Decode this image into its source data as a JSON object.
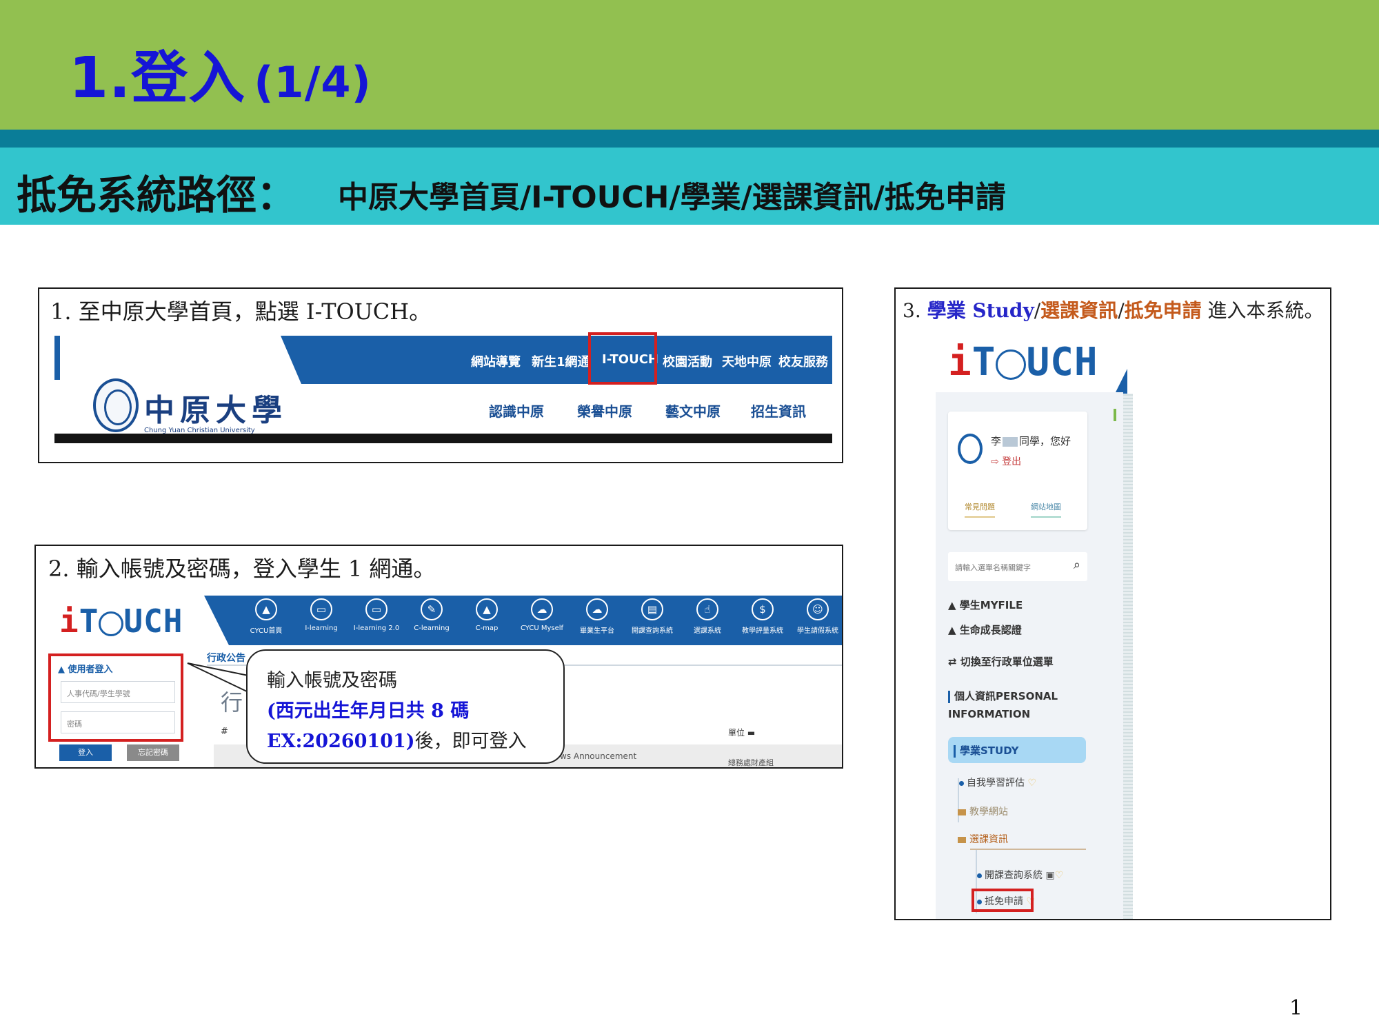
{
  "slide": {
    "title": "1.登入",
    "page_fraction": "(1/4)",
    "path_label": "抵免系統路徑：",
    "path_text": "中原大學首頁/I-TOUCH/學業/選課資訊/抵免申請",
    "page_number": "1"
  },
  "step1": {
    "caption": "1. 至中原大學首頁，點選 I-TOUCH。",
    "top_nav": [
      "網站導覽",
      "新生1網通",
      "I-TOUCH",
      "校園活動",
      "天地中原",
      "校友服務"
    ],
    "logo_cn": "中原大學",
    "logo_en": "Chung Yuan Christian University",
    "sub_nav": [
      "認識中原",
      "榮譽中原",
      "藝文中原",
      "招生資訊"
    ]
  },
  "step2": {
    "caption": "2. 輸入帳號及密碼，登入學生 1 網通。",
    "logo": {
      "i": "i",
      "t": "T",
      "uch": "UCH"
    },
    "nav_items": [
      {
        "icon": "building-icon",
        "glyph": "▲",
        "label": "CYCU首頁"
      },
      {
        "icon": "monitor-icon",
        "glyph": "▭",
        "label": "I-learning"
      },
      {
        "icon": "monitor-new-icon",
        "glyph": "▭",
        "label": "I-learning 2.0"
      },
      {
        "icon": "pencil-icon",
        "glyph": "✎",
        "label": "C-learning"
      },
      {
        "icon": "mountain-icon",
        "glyph": "▲",
        "label": "C-map"
      },
      {
        "icon": "cloud-icon",
        "glyph": "☁",
        "label": "CYCU Myself"
      },
      {
        "icon": "cloud-icon",
        "glyph": "☁",
        "label": "畢業生平台"
      },
      {
        "icon": "chat-icon",
        "glyph": "▤",
        "label": "開課查詢系統"
      },
      {
        "icon": "pointer-icon",
        "glyph": "☝",
        "label": "選課系統"
      },
      {
        "icon": "dollar-icon",
        "glyph": "$",
        "label": "教學評量系統"
      },
      {
        "icon": "person-icon",
        "glyph": "☺",
        "label": "學生請假系統"
      }
    ],
    "login": {
      "title": "使用者登入",
      "account_placeholder": "人事代碼/學生學號",
      "password_placeholder": "密碼",
      "login_button": "登入",
      "forgot_button": "忘記密碼"
    },
    "admin_tab": "行政公告",
    "big_char": "行",
    "col_hash": "#",
    "col_unit": "單位 ▬",
    "row_text": "ws Announcement",
    "row_text2": "總務處財產組",
    "callout": {
      "line1": "輸入帳號及密碼",
      "line2": "(西元出生年月日共 8 碼",
      "line3_code": "EX:20260101)",
      "line3_rest": "後，即可登入"
    }
  },
  "step3": {
    "caption_prefix": "3. ",
    "caption_study": "學業 Study",
    "caption_sep1": "/",
    "caption_course": "選課資訊",
    "caption_sep2": "/",
    "caption_apply": "抵免申請",
    "caption_suffix": " 進入本系統。",
    "user_name_pre": "李",
    "user_name_post": "同學，您好",
    "logout": "⇨ 登出",
    "faq": "常見問題",
    "sitemap": "網站地圖",
    "search_placeholder": "請輸入選單名稱關鍵字",
    "menu": {
      "myfile": "學生MYFILE",
      "growth": "生命成長認證",
      "switch": "切換至行政單位選單",
      "personal_1": "個人資訊PERSONAL",
      "personal_2": "INFORMATION",
      "study": "學業STUDY",
      "self_eval": "自我學習評估",
      "teaching_site": "教學網站",
      "course_info": "選課資訊",
      "course_query": "開課查詢系統",
      "credit_apply": "抵免申請"
    }
  },
  "colors": {
    "header_green": "#92c050",
    "band_teal": "#0a7d98",
    "band_cyan": "#32c5cd",
    "title_blue": "#1515d6",
    "highlight_red": "#d42020",
    "nav_blue": "#1a5fa8"
  }
}
